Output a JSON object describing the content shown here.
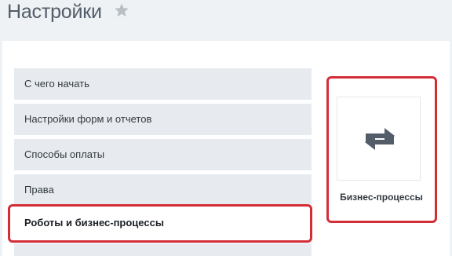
{
  "header": {
    "title": "Настройки",
    "favorite_icon": "star-icon"
  },
  "menu": {
    "items": [
      {
        "label": "С чего начать",
        "active": false
      },
      {
        "label": "Настройки форм и отчетов",
        "active": false
      },
      {
        "label": "Способы оплаты",
        "active": false
      },
      {
        "label": "Права",
        "active": false
      },
      {
        "label": "Роботы и бизнес-процессы",
        "active": true
      }
    ]
  },
  "tile": {
    "label": "Бизнес-процессы",
    "icon": "repeat-arrows-icon"
  },
  "colors": {
    "highlight": "#d32e37",
    "menu_bg": "#e7ebef",
    "page_bg": "#eef2f4",
    "icon": "#535c69"
  }
}
